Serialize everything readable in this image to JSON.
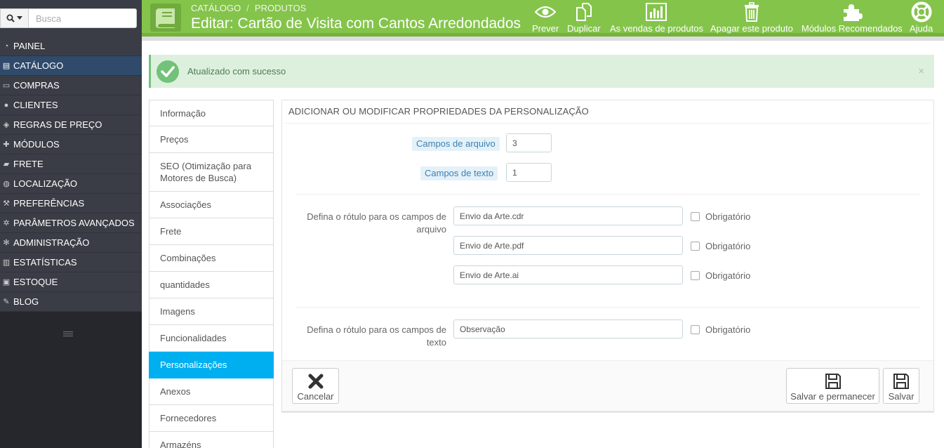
{
  "search": {
    "placeholder": "Busca",
    "mode_icon": "search-icon"
  },
  "sidebar": {
    "items": [
      {
        "label": "PAINEL",
        "icon": "dashboard-icon"
      },
      {
        "label": "CATÁLOGO",
        "icon": "book-icon",
        "active": true
      },
      {
        "label": "COMPRAS",
        "icon": "credit-card-icon"
      },
      {
        "label": "CLIENTES",
        "icon": "users-icon"
      },
      {
        "label": "REGRAS DE PREÇO",
        "icon": "tags-icon"
      },
      {
        "label": "MÓDULOS",
        "icon": "puzzle-icon"
      },
      {
        "label": "FRETE",
        "icon": "truck-icon"
      },
      {
        "label": "LOCALIZAÇÃO",
        "icon": "globe-icon"
      },
      {
        "label": "PREFERÊNCIAS",
        "icon": "wrench-icon"
      },
      {
        "label": "PARÂMETROS AVANÇADOS",
        "icon": "cogs-icon"
      },
      {
        "label": "ADMINISTRAÇÃO",
        "icon": "cog-icon"
      },
      {
        "label": "ESTATÍSTICAS",
        "icon": "bar-chart-icon"
      },
      {
        "label": "ESTOQUE",
        "icon": "archive-icon"
      },
      {
        "label": "BLOG",
        "icon": "edit-icon"
      }
    ]
  },
  "header": {
    "breadcrumb": [
      "CATÁLOGO",
      "PRODUTOS"
    ],
    "breadcrumb_separator": "/",
    "title": "Editar: Cartão de Visita com Cantos Arredondados",
    "accent": "#84c44b",
    "toolbar": [
      {
        "label": "Prever",
        "icon": "eye-icon"
      },
      {
        "label": "Duplicar",
        "icon": "copy-icon"
      },
      {
        "label": "As vendas de produtos",
        "icon": "bar-chart-icon"
      },
      {
        "label": "Apagar este produto",
        "icon": "trash-icon"
      },
      {
        "label": "Módulos Recomendados",
        "icon": "puzzle-icon"
      },
      {
        "label": "Ajuda",
        "icon": "lifebuoy-icon"
      }
    ]
  },
  "alert": {
    "text": "Atualizado com sucesso",
    "close": "×",
    "color": "#72c279"
  },
  "tabs": [
    {
      "label": "Informação"
    },
    {
      "label": "Preços"
    },
    {
      "label": "SEO (Otimização para Motores de Busca)"
    },
    {
      "label": "Associações"
    },
    {
      "label": "Frete"
    },
    {
      "label": "Combinações"
    },
    {
      "label": "quantidades"
    },
    {
      "label": "Imagens"
    },
    {
      "label": "Funcionalidades"
    },
    {
      "label": "Personalizações",
      "active": true
    },
    {
      "label": "Anexos"
    },
    {
      "label": "Fornecedores"
    },
    {
      "label": "Armazéns"
    }
  ],
  "panel": {
    "heading": "Adicionar ou modificar propriedades da personalização",
    "file_fields": {
      "label": "Campos de arquivo",
      "value": "3"
    },
    "text_fields": {
      "label": "Campos de texto",
      "value": "1"
    },
    "file_labels_group": "Defina o rótulo para os campos de arquivo",
    "file_labels": [
      {
        "value": "Envio da Arte.cdr",
        "required_label": "Obrigatório"
      },
      {
        "value": "Envio de Arte.pdf",
        "required_label": "Obrigatório"
      },
      {
        "value": "Envio de Arte.ai",
        "required_label": "Obrigatório"
      }
    ],
    "text_labels_group": "Defina o rótulo para os campos de texto",
    "text_labels": [
      {
        "value": "Observação",
        "required_label": "Obrigatório"
      }
    ],
    "footer": {
      "cancel": "Cancelar",
      "save_stay": "Salvar e permanecer",
      "save": "Salvar"
    }
  }
}
